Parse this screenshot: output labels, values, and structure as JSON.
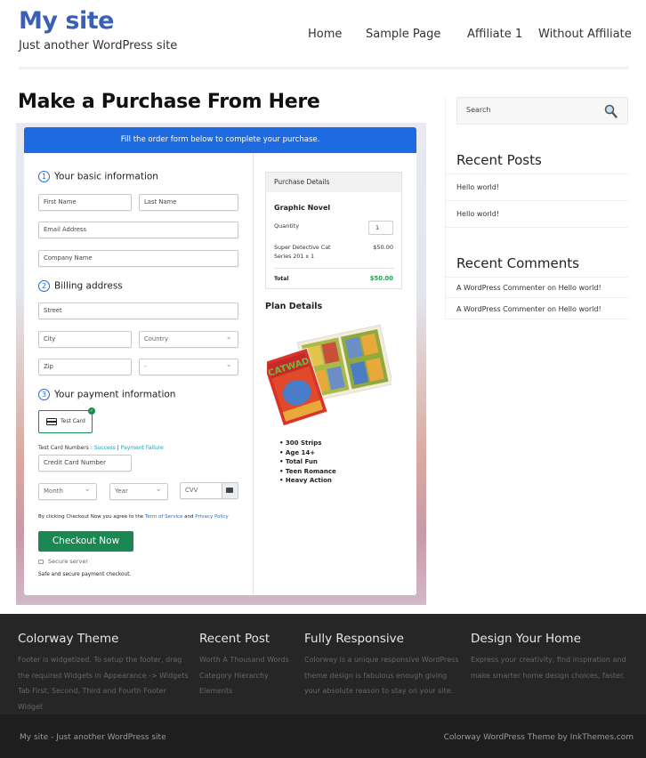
{
  "header": {
    "site_title": "My site",
    "tagline": "Just another WordPress site",
    "nav": [
      {
        "label": "Home"
      },
      {
        "label": "Sample Page"
      },
      {
        "label": "Affiliate 1"
      },
      {
        "label": "Without Affiliate"
      }
    ]
  },
  "page": {
    "title": "Make a Purchase From Here"
  },
  "form": {
    "banner": "Fill the order form below to complete your purchase.",
    "sections": [
      {
        "num": "1",
        "title": "Your basic information"
      },
      {
        "num": "2",
        "title": "Billing address"
      },
      {
        "num": "3",
        "title": "Your payment information"
      }
    ],
    "fields": {
      "first_name": "First Name",
      "last_name": "Last Name",
      "email": "Email Address",
      "company": "Company Name",
      "street": "Street",
      "city": "City",
      "country": "Country",
      "zip": "Zip",
      "state": "-",
      "card_number": "Credit Card Number",
      "month": "Month",
      "year": "Year",
      "cvv": "CVV"
    },
    "payment_method": "Test Card",
    "test_numbers_label": "Test Card Numbers : ",
    "test_success": "Success",
    "test_separator": " | ",
    "test_failure": "Payment Failure",
    "agree_prefix": "By clicking Checkout Now you agree to the ",
    "terms_link": "Term of Service",
    "agree_and": " and ",
    "privacy_link": "Privacy Policy",
    "checkout_button": "Checkout Now",
    "secure_server": "Secure server",
    "safe_text": "Safe and secure payment checkout."
  },
  "purchase": {
    "heading": "Purchase Details",
    "product": "Graphic Novel",
    "quantity_label": "Quantity",
    "quantity": "1",
    "item_name": "Super Detective Cat Series 201 x 1",
    "item_price": "$50.00",
    "total_label": "Total",
    "total": "$50.00"
  },
  "plan": {
    "heading": "Plan Details",
    "features": [
      "300 Strips",
      "Age 14+",
      "Total Fun",
      "Teen Romance",
      "Heavy Action"
    ]
  },
  "sidebar": {
    "search_placeholder": "Search",
    "recent_posts_title": "Recent Posts",
    "recent_posts": [
      "Hello world!",
      "Hello world!"
    ],
    "recent_comments_title": "Recent Comments",
    "recent_comments": [
      "A WordPress Commenter on Hello world!",
      "A WordPress Commenter on Hello world!"
    ]
  },
  "footer": {
    "columns": [
      {
        "title": "Colorway Theme",
        "text": "Footer is widgetized. To setup the footer, drag the required Widgets in Appearance -> Widgets Tab First, Second, Third and Fourth Footer Widget"
      },
      {
        "title": "Recent Post",
        "links": [
          "Worth A Thousand Words",
          "Category Hierarchy",
          "Elements"
        ]
      },
      {
        "title": "Fully Responsive",
        "text": "Colorway is a unique responsive WordPress theme design is fabulous enough giving your absolute reason to stay on your site."
      },
      {
        "title": "Design Your Home",
        "text": "Express your creativity, find inspiration and make smarter home design choices, faster."
      }
    ],
    "bottom_left": "My site - Just another WordPress site",
    "bottom_right": "Colorway WordPress Theme by InkThemes.com"
  },
  "colors": {
    "brand_blue": "#3b5fb8",
    "banner_blue": "#1e6ae0",
    "checkout_green": "#1b8752",
    "total_green": "#21a14c",
    "footer_bg": "#262626"
  }
}
